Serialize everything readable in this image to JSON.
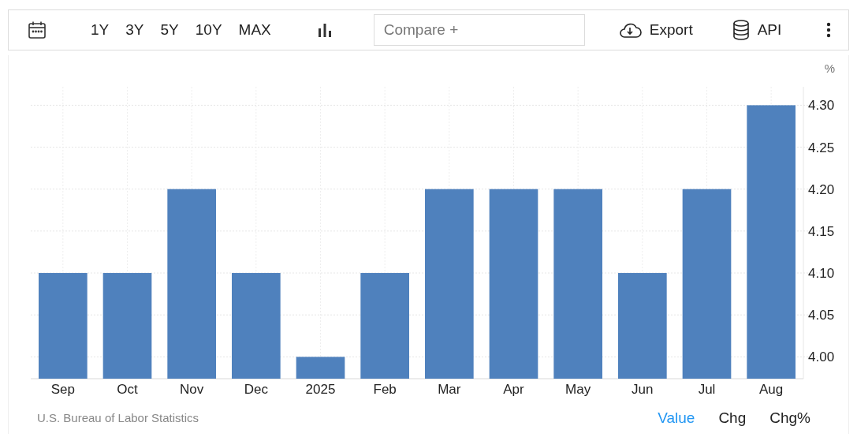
{
  "toolbar": {
    "ranges": [
      {
        "label": "1Y"
      },
      {
        "label": "3Y"
      },
      {
        "label": "5Y"
      },
      {
        "label": "10Y"
      },
      {
        "label": "MAX"
      }
    ],
    "compare": {
      "placeholder": "Compare +"
    },
    "export": "Export",
    "api": "API"
  },
  "chart": {
    "unit": "%",
    "chart_data": {
      "type": "bar",
      "categories": [
        "Sep",
        "Oct",
        "Nov",
        "Dec",
        "2025",
        "Feb",
        "Mar",
        "Apr",
        "May",
        "Jun",
        "Jul",
        "Aug"
      ],
      "grid": true,
      "series": [
        {
          "color": "#4f81bd",
          "values": [
            4.1,
            4.1,
            4.2,
            4.1,
            4.0,
            4.1,
            4.2,
            4.2,
            4.2,
            4.1,
            4.2,
            4.3
          ]
        }
      ],
      "ylim": [
        3.974,
        4.322
      ],
      "yticks": [
        {
          "value": 4.0,
          "label": "4.00"
        },
        {
          "value": 4.05,
          "label": "4.05"
        },
        {
          "value": 4.1,
          "label": "4.10"
        },
        {
          "value": 4.15,
          "label": "4.15"
        },
        {
          "value": 4.2,
          "label": "4.20"
        },
        {
          "value": 4.25,
          "label": "4.25"
        },
        {
          "value": 4.3,
          "label": "4.30"
        }
      ]
    }
  },
  "footer": {
    "source": "U.S. Bureau of Labor Statistics",
    "views": [
      {
        "label": "Value",
        "selected": true
      },
      {
        "label": "Chg",
        "selected": false
      },
      {
        "label": "Chg%",
        "selected": false
      }
    ]
  }
}
